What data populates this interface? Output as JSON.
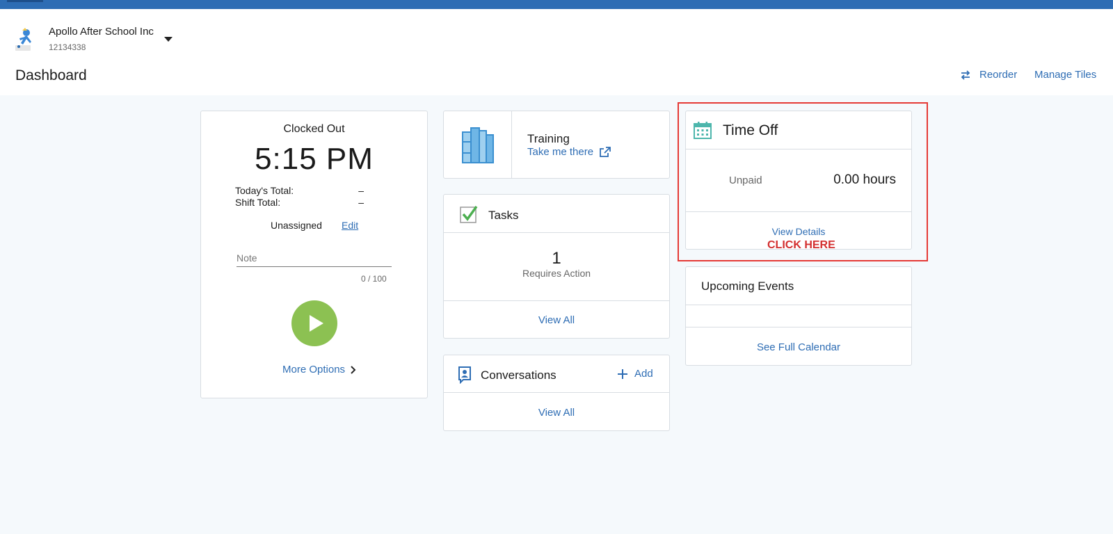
{
  "header": {
    "company_name": "Apollo After School Inc",
    "company_id": "12134338",
    "page_title": "Dashboard",
    "reorder_label": "Reorder",
    "manage_tiles_label": "Manage Tiles"
  },
  "clock": {
    "status": "Clocked Out",
    "time": "5:15 PM",
    "todays_total_label": "Today's Total:",
    "todays_total_value": "–",
    "shift_total_label": "Shift Total:",
    "shift_total_value": "–",
    "assignment": "Unassigned",
    "edit_label": "Edit",
    "note_placeholder": "Note",
    "note_count": "0 / 100",
    "more_options_label": "More Options",
    "play_color": "#8cc152"
  },
  "training": {
    "title": "Training",
    "link_label": "Take me there"
  },
  "tasks": {
    "title": "Tasks",
    "count": "1",
    "count_label": "Requires Action",
    "view_all_label": "View All"
  },
  "conversations": {
    "title": "Conversations",
    "add_label": "Add",
    "view_all_label": "View All"
  },
  "time_off": {
    "title": "Time Off",
    "type_label": "Unpaid",
    "hours": "0.00 hours",
    "view_details_label": "View Details",
    "annotation": "CLICK HERE",
    "highlight_color": "#e53935"
  },
  "upcoming_events": {
    "title": "Upcoming Events",
    "calendar_label": "See Full Calendar"
  },
  "colors": {
    "brand": "#2e6db4",
    "link": "#2e6db4",
    "background": "#f5f9fc"
  }
}
